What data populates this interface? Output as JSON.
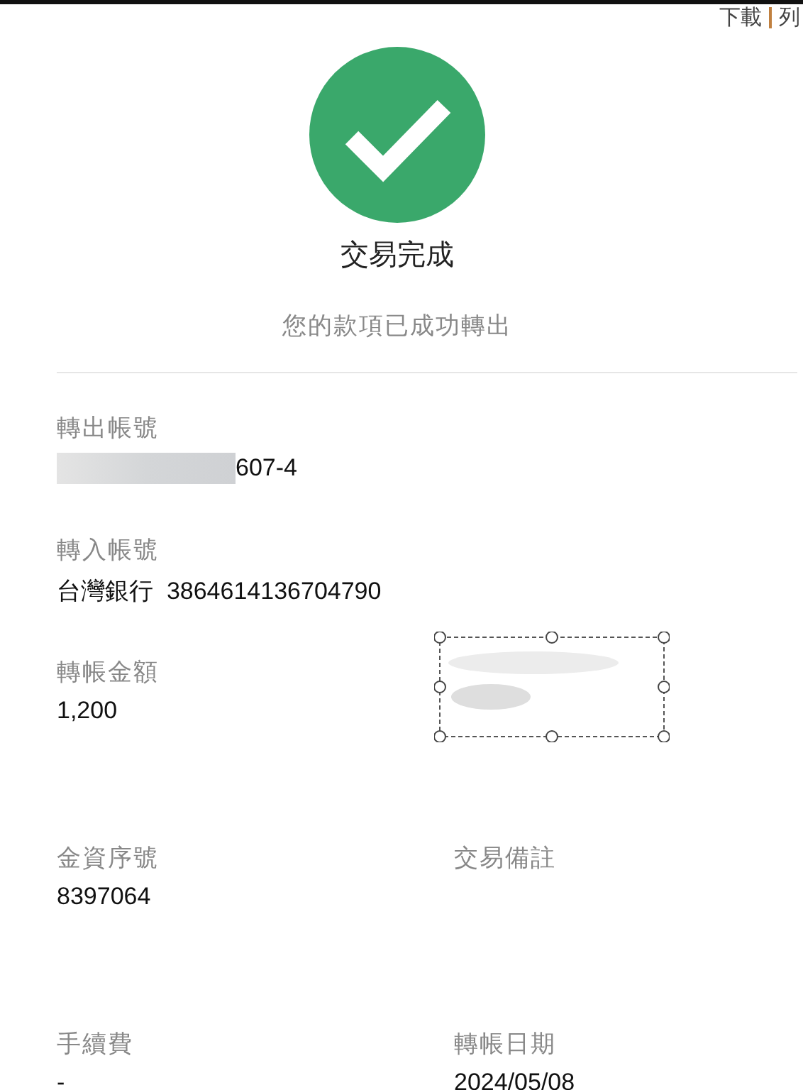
{
  "top_links": [
    "下載",
    "列"
  ],
  "status": {
    "title": "交易完成",
    "message": "您的款項已成功轉出"
  },
  "rows": [
    {
      "cells": [
        {
          "kind": "masked",
          "label": "轉出帳號",
          "value": "607-4"
        }
      ]
    },
    {
      "cells": [
        {
          "kind": "plain",
          "label": "轉入帳號",
          "value": "台灣銀行  3864614136704790"
        }
      ]
    },
    {
      "cells": [
        {
          "kind": "plain",
          "label": "轉帳金額",
          "value": "1,200"
        },
        {
          "kind": "selection"
        }
      ]
    },
    {
      "cells": [
        {
          "kind": "plain",
          "label": "金資序號",
          "value": "8397064"
        },
        {
          "kind": "plain",
          "label": "交易備註"
        }
      ]
    },
    {
      "cells": [
        {
          "kind": "plain",
          "label": "手續費",
          "value": "-"
        },
        {
          "kind": "plain",
          "label": "轉帳日期",
          "value": "2024/05/08"
        }
      ]
    }
  ]
}
